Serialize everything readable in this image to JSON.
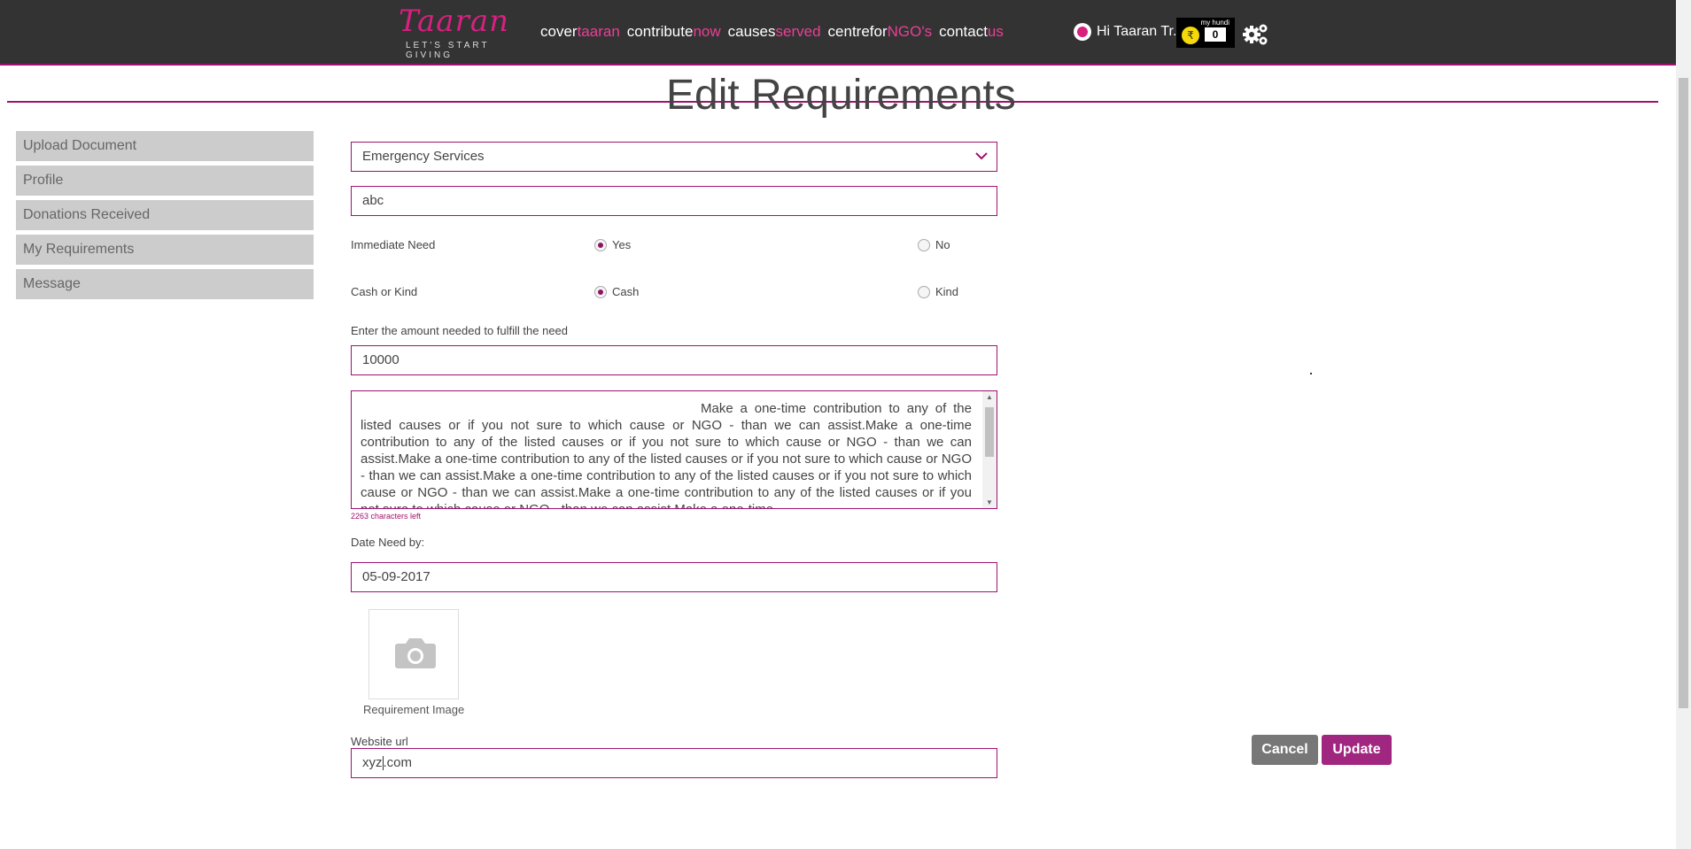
{
  "header": {
    "logo_text": "Taaran",
    "logo_tagline": "LET'S START GIVING",
    "nav": [
      {
        "white": "cover",
        "pink": "taaran"
      },
      {
        "white": "contribute",
        "pink": "now"
      },
      {
        "white": "causes",
        "pink": "served"
      },
      {
        "white": "centrefor",
        "pink": "NGO's"
      },
      {
        "white": "contact",
        "pink": "us"
      }
    ],
    "greeting": "Hi Taaran Tr...",
    "hundi_label": "my hundi",
    "hundi_coin": "₹",
    "hundi_count": "0"
  },
  "page": {
    "title": "Edit Requirements"
  },
  "sidebar": {
    "items": [
      {
        "label": "Upload Document"
      },
      {
        "label": "Profile"
      },
      {
        "label": "Donations Received"
      },
      {
        "label": "My Requirements"
      },
      {
        "label": "Message"
      }
    ]
  },
  "form": {
    "category": "Emergency Services",
    "title_value": "abc",
    "immediate_need": {
      "label": "Immediate Need",
      "yes": "Yes",
      "no": "No",
      "selected": "Yes"
    },
    "cash_or_kind": {
      "label": "Cash or Kind",
      "cash": "Cash",
      "kind": "Kind",
      "selected": "Cash"
    },
    "amount_label": "Enter the amount needed to fulfill the need",
    "amount_value": "10000",
    "description": "Make a one-time contribution to any of the listed causes or if you not sure to which cause or NGO - than we can assist.Make a one-time contribution to any of the listed causes or if you not sure to which cause or NGO - than we can assist.Make a one-time contribution to any of the listed causes or if you not sure to which cause or NGO - than we can assist.Make a one-time contribution to any of the listed causes or if you not sure to which cause or NGO - than we can assist.Make a one-time contribution to any of the listed causes or if you not sure to which cause or NGO - than we can assist.Make a one-time",
    "chars_left": "2263 characters left",
    "date_label": "Date Need by:",
    "date_value": "05-09-2017",
    "image_caption": "Requirement Image",
    "website_label": "Website url",
    "website_value_before_cursor": "xyz",
    "website_value_after_cursor": ".com"
  },
  "actions": {
    "cancel": "Cancel",
    "update": "Update"
  },
  "colors": {
    "topbar": "#333333",
    "accent": "#a0126f",
    "pink": "#ea3f96",
    "update_button": "#a0267f",
    "cancel_button": "#777777",
    "sidebar_item": "#cccccc"
  }
}
